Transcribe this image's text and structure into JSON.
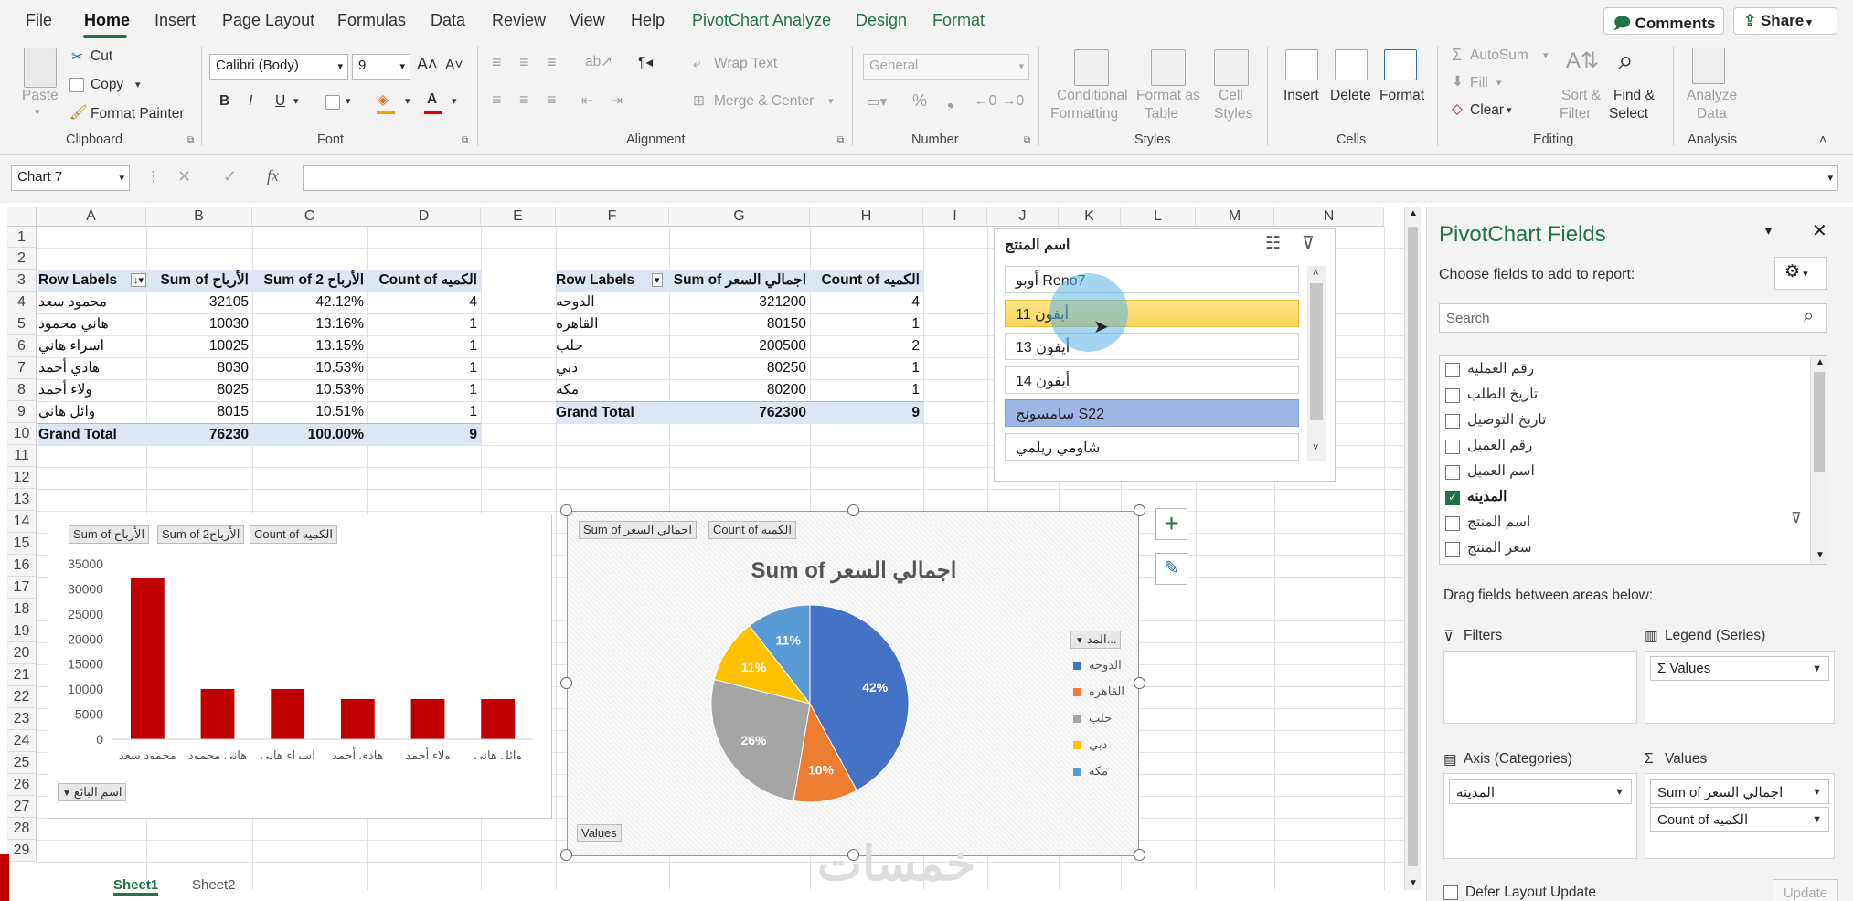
{
  "menu": {
    "file": "File",
    "home": "Home",
    "insert": "Insert",
    "page_layout": "Page Layout",
    "formulas": "Formulas",
    "data": "Data",
    "review": "Review",
    "view": "View",
    "help": "Help",
    "pivotchart_analyze": "PivotChart Analyze",
    "design": "Design",
    "format": "Format",
    "comments": "Comments",
    "share": "Share"
  },
  "ribbon": {
    "paste": "Paste",
    "cut": "Cut",
    "copy": "Copy",
    "format_painter": "Format Painter",
    "clipboard": "Clipboard",
    "font_name": "Calibri (Body)",
    "font_size": "9",
    "font": "Font",
    "bold": "B",
    "italic": "I",
    "underline": "U",
    "wrap_text": "Wrap Text",
    "merge_center": "Merge & Center",
    "alignment": "Alignment",
    "number_format": "General",
    "number": "Number",
    "conditional_formatting_1": "Conditional",
    "conditional_formatting_2": "Formatting",
    "format_as_table_1": "Format as",
    "format_as_table_2": "Table",
    "cell_styles_1": "Cell",
    "cell_styles_2": "Styles",
    "styles": "Styles",
    "insert": "Insert",
    "delete": "Delete",
    "format": "Format",
    "cells": "Cells",
    "autosum": "AutoSum",
    "fill": "Fill",
    "clear": "Clear",
    "sort_filter_1": "Sort &",
    "sort_filter_2": "Filter",
    "find_select_1": "Find &",
    "find_select_2": "Select",
    "editing": "Editing",
    "analyze_data_1": "Analyze",
    "analyze_data_2": "Data",
    "analysis": "Analysis"
  },
  "formula_bar": {
    "name_box": "Chart 7",
    "fx": "fx",
    "content": ""
  },
  "columns": [
    "A",
    "B",
    "C",
    "D",
    "E",
    "F",
    "G",
    "H",
    "I",
    "J",
    "K",
    "L",
    "M",
    "N"
  ],
  "rows": [
    "1",
    "2",
    "3",
    "4",
    "5",
    "6",
    "7",
    "8",
    "9",
    "10",
    "11",
    "12",
    "13",
    "14",
    "15",
    "16",
    "17",
    "18",
    "19",
    "20",
    "21",
    "22",
    "23",
    "24",
    "25",
    "26",
    "27",
    "28",
    "29"
  ],
  "pivot1": {
    "headers": [
      "Row Labels",
      "Sum of الأرباح",
      "Sum of الأرباح 2",
      "Count of الكميه"
    ],
    "rows": [
      [
        "محمود سعد",
        "32105",
        "42.12%",
        "4"
      ],
      [
        "هاني محمود",
        "10030",
        "13.16%",
        "1"
      ],
      [
        "اسراء هاني",
        "10025",
        "13.15%",
        "1"
      ],
      [
        "هادي أحمد",
        "8030",
        "10.53%",
        "1"
      ],
      [
        "ولاء أحمد",
        "8025",
        "10.53%",
        "1"
      ],
      [
        "وائل هاني",
        "8015",
        "10.51%",
        "1"
      ]
    ],
    "total": [
      "Grand Total",
      "76230",
      "100.00%",
      "9"
    ]
  },
  "pivot2": {
    "headers": [
      "Row Labels",
      "Sum of اجمالي السعر",
      "Count of الكميه"
    ],
    "rows": [
      [
        "الدوحه",
        "321200",
        "4"
      ],
      [
        "القاهره",
        "80150",
        "1"
      ],
      [
        "حلب",
        "200500",
        "2"
      ],
      [
        "دبي",
        "80250",
        "1"
      ],
      [
        "مكه",
        "80200",
        "1"
      ]
    ],
    "total": [
      "Grand Total",
      "762300",
      "9"
    ]
  },
  "slicer": {
    "title": "اسم المنتج",
    "items": [
      "أوبو Reno7",
      "أيفون 11",
      "أيفون 13",
      "أيفون 14",
      "سامسونج S22",
      "شاومي ريلمي"
    ]
  },
  "chart_data": [
    {
      "type": "bar",
      "field_buttons": [
        "Sum of الأرباح",
        "Sum of الأرباح2",
        "Count of الكميه"
      ],
      "axis_field_button": "اسم البائع",
      "categories": [
        "محمود سعد",
        "هاني محمود",
        "اسراء هاني",
        "هادي أحمد",
        "ولاء أحمد",
        "وائل هاني"
      ],
      "values": [
        32105,
        10030,
        10025,
        8030,
        8025,
        8015
      ],
      "yticks": [
        "35000",
        "30000",
        "25000",
        "20000",
        "15000",
        "10000",
        "5000",
        "0"
      ],
      "ylim": [
        0,
        35000
      ],
      "color": "#c00000"
    },
    {
      "type": "pie",
      "title": "Sum of اجمالي السعر",
      "field_buttons": [
        "Sum of اجمالي السعر",
        "Count of الكميه"
      ],
      "values_button": "Values",
      "legend_title": "المد...",
      "categories": [
        "الدوحه",
        "القاهره",
        "حلب",
        "دبي",
        "مكه"
      ],
      "values": [
        321200,
        80150,
        200500,
        80250,
        80200
      ],
      "labels": [
        "42%",
        "10%",
        "26%",
        "11%",
        "11%"
      ],
      "colors": [
        "#4472c4",
        "#ed7d31",
        "#a5a5a5",
        "#ffc000",
        "#5b9bd5"
      ],
      "legend_position": "right"
    }
  ],
  "pane": {
    "title": "PivotChart Fields",
    "subtitle": "Choose fields to add to report:",
    "search_placeholder": "Search",
    "fields": [
      "رقم العمليه",
      "تاريخ الطلب",
      "تاريخ التوصيل",
      "رقم العميل",
      "اسم العميل",
      "المدينه",
      "اسم المنتج",
      "سعر المنتج"
    ],
    "drag_text": "Drag fields between areas below:",
    "filters": "Filters",
    "legend": "Legend (Series)",
    "legend_item": "Σ Values",
    "axis": "Axis (Categories)",
    "axis_item": "المدينه",
    "values": "Values",
    "values_item_1": "Sum of اجمالي السعر",
    "values_item_2": "Count of الكميه",
    "defer": "Defer Layout Update",
    "update": "Update"
  },
  "sheet_tabs": [
    "Sheet1",
    "Sheet2"
  ],
  "watermark": "خمسات"
}
